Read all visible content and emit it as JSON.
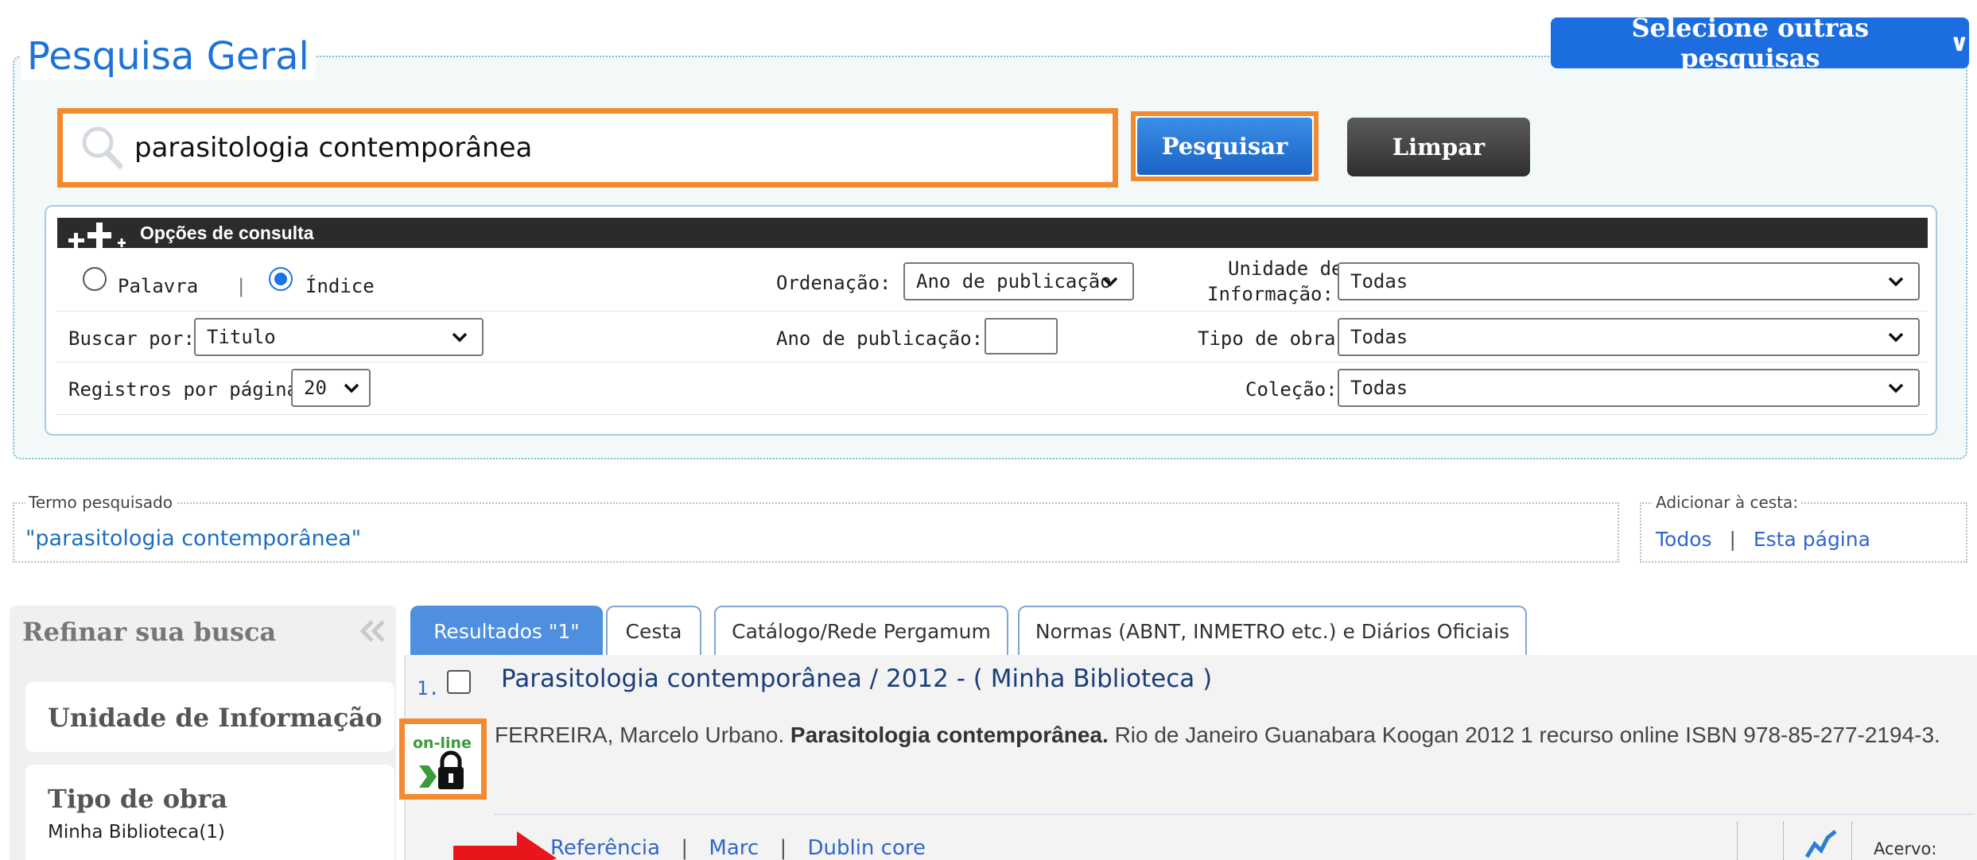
{
  "search": {
    "legend": "Pesquisa Geral",
    "query": "parasitologia contemporânea",
    "search_button": "Pesquisar",
    "clear_button": "Limpar",
    "other_searches": "Selecione outras pesquisas"
  },
  "options": {
    "header": "Opções de consulta",
    "radio_palavra": "Palavra",
    "radio_separator": "|",
    "radio_indice": "Índice",
    "selected_mode": "Índice",
    "buscar_por_label": "Buscar por:",
    "buscar_por_value": "Titulo",
    "registros_label": "Registros por página:",
    "registros_value": "20",
    "ordenacao_label": "Ordenação:",
    "ordenacao_value": "Ano de publicação",
    "ano_label": "Ano de publicação:",
    "ano_value": "",
    "unidade_label_line1": "Unidade de",
    "unidade_label_line2": "Informação:",
    "unidade_value": "Todas",
    "tipo_label": "Tipo de obra:",
    "tipo_value": "Todas",
    "colecao_label": "Coleção:",
    "colecao_value": "Todas"
  },
  "term": {
    "legend": "Termo pesquisado",
    "value": "\"parasitologia contemporânea\""
  },
  "basket": {
    "legend": "Adicionar à cesta:",
    "all": "Todos",
    "separator": "|",
    "page": "Esta página"
  },
  "sidebar": {
    "title": "Refinar sua busca",
    "facets": [
      {
        "title": "Unidade de Informação"
      },
      {
        "title": "Tipo de obra",
        "items": [
          "Minha Biblioteca(1)"
        ]
      }
    ]
  },
  "tabs": [
    {
      "label": "Resultados \"1\"",
      "active": true
    },
    {
      "label": "Cesta",
      "active": false
    },
    {
      "label": "Catálogo/Rede Pergamum",
      "active": false
    },
    {
      "label": "Normas (ABNT, INMETRO etc.) e Diários Oficiais",
      "active": false
    }
  ],
  "result": {
    "number": "1.",
    "title": "Parasitologia contemporânea / 2012 - ( Minha Biblioteca )",
    "author": "FERREIRA, Marcelo Urbano.",
    "bold_title": "Parasitologia contemporânea.",
    "rest": "Rio de Janeiro Guanabara Koogan 2012 1 recurso online ISBN 978-85-277-2194-3.",
    "online_badge": "on-line",
    "links": [
      "Referência",
      "Marc",
      "Dublin core"
    ],
    "link_separator": "|",
    "acervo_label": "Acervo:"
  },
  "colors": {
    "accent": "#1c6de0",
    "highlight": "#f28a30",
    "link": "#3066cc",
    "tab_active": "#4f8fdf"
  }
}
